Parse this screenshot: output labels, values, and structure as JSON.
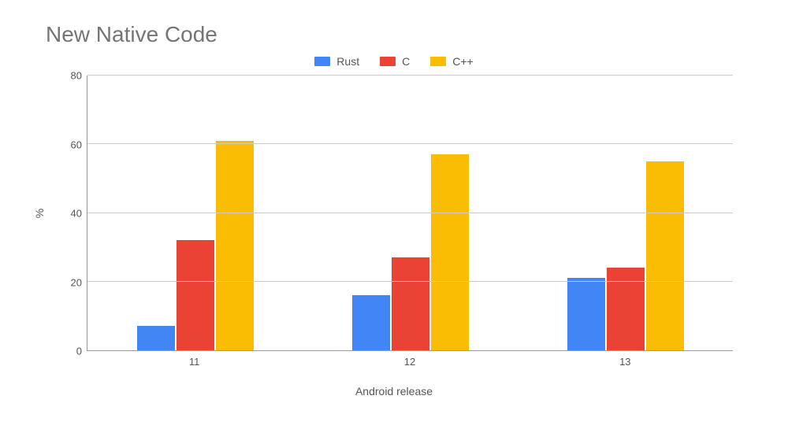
{
  "chart_data": {
    "type": "bar",
    "title": "New Native Code",
    "xlabel": "Android release",
    "ylabel": "%",
    "ylim": [
      0,
      80
    ],
    "yticks": [
      0,
      20,
      40,
      60,
      80
    ],
    "categories": [
      "11",
      "12",
      "13"
    ],
    "series": [
      {
        "name": "Rust",
        "color": "#4285F4",
        "values": [
          7,
          16,
          21
        ]
      },
      {
        "name": "C",
        "color": "#EA4335",
        "values": [
          32,
          27,
          24
        ]
      },
      {
        "name": "C++",
        "color": "#FBBC04",
        "values": [
          61,
          57,
          55
        ]
      }
    ]
  }
}
